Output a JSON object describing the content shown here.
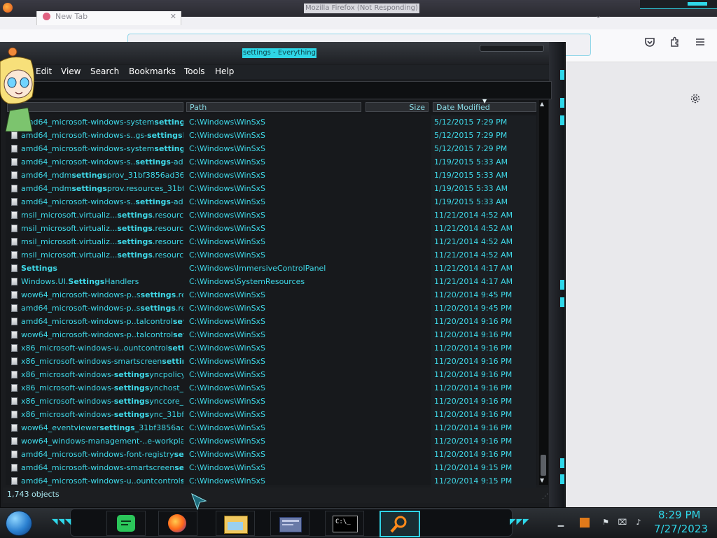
{
  "firefox": {
    "title": "Mozilla Firefox (Not Responding)",
    "tab_label": "New Tab",
    "tab_close": "✕"
  },
  "everything": {
    "title": "settings - Everything",
    "menu": [
      "Edit",
      "View",
      "Search",
      "Bookmarks",
      "Tools",
      "Help"
    ],
    "search_value": "",
    "columns": {
      "name": "",
      "path": "Path",
      "size": "Size",
      "date": "Date Modified"
    },
    "rows": [
      {
        "pre": "amd64_microsoft-windows-system",
        "hl": "settings",
        "post": "...",
        "path": "C:\\Windows\\WinSxS",
        "date": "5/12/2015 7:29 PM"
      },
      {
        "pre": "amd64_microsoft-windows-s..gs-",
        "hl": "settings",
        "post": "h...",
        "path": "C:\\Windows\\WinSxS",
        "date": "5/12/2015 7:29 PM"
      },
      {
        "pre": "amd64_microsoft-windows-system",
        "hl": "settings",
        "post": "...",
        "path": "C:\\Windows\\WinSxS",
        "date": "5/12/2015 7:29 PM"
      },
      {
        "pre": "amd64_microsoft-windows-s..",
        "hl": "settings",
        "post": "-ad...",
        "path": "C:\\Windows\\WinSxS",
        "date": "1/19/2015 5:33 AM"
      },
      {
        "pre": "amd64_mdm",
        "hl": "settings",
        "post": "prov_31bf3856ad364e...",
        "path": "C:\\Windows\\WinSxS",
        "date": "1/19/2015 5:33 AM"
      },
      {
        "pre": "amd64_mdm",
        "hl": "settings",
        "post": "prov.resources_31bf3...",
        "path": "C:\\Windows\\WinSxS",
        "date": "1/19/2015 5:33 AM"
      },
      {
        "pre": "amd64_microsoft-windows-s..",
        "hl": "settings",
        "post": "-ad...",
        "path": "C:\\Windows\\WinSxS",
        "date": "1/19/2015 5:33 AM"
      },
      {
        "pre": "msil_microsoft.virtualiz...",
        "hl": "settings",
        "post": ".resources...",
        "path": "C:\\Windows\\WinSxS",
        "date": "11/21/2014 4:52 AM"
      },
      {
        "pre": "msil_microsoft.virtualiz...",
        "hl": "settings",
        "post": ".resources...",
        "path": "C:\\Windows\\WinSxS",
        "date": "11/21/2014 4:52 AM"
      },
      {
        "pre": "msil_microsoft.virtualiz...",
        "hl": "settings",
        "post": ".resources...",
        "path": "C:\\Windows\\WinSxS",
        "date": "11/21/2014 4:52 AM"
      },
      {
        "pre": "msil_microsoft.virtualiz...",
        "hl": "settings",
        "post": ".resources...",
        "path": "C:\\Windows\\WinSxS",
        "date": "11/21/2014 4:52 AM"
      },
      {
        "pre": "",
        "hl": "Settings",
        "post": "",
        "path": "C:\\Windows\\ImmersiveControlPanel",
        "date": "11/21/2014 4:17 AM"
      },
      {
        "pre": "Windows.UI.",
        "hl": "Settings",
        "post": "Handlers",
        "path": "C:\\Windows\\SystemResources",
        "date": "11/21/2014 4:17 AM"
      },
      {
        "pre": "wow64_microsoft-windows-p..s",
        "hl": "settings",
        "post": ".res...",
        "path": "C:\\Windows\\WinSxS",
        "date": "11/20/2014 9:45 PM"
      },
      {
        "pre": "amd64_microsoft-windows-p..s",
        "hl": "settings",
        "post": ".res...",
        "path": "C:\\Windows\\WinSxS",
        "date": "11/20/2014 9:45 PM"
      },
      {
        "pre": "amd64_microsoft-windows-p..talcontrol",
        "hl": "set...",
        "post": "",
        "path": "C:\\Windows\\WinSxS",
        "date": "11/20/2014 9:16 PM"
      },
      {
        "pre": "wow64_microsoft-windows-p..talcontrol",
        "hl": "set...",
        "post": "",
        "path": "C:\\Windows\\WinSxS",
        "date": "11/20/2014 9:16 PM"
      },
      {
        "pre": "x86_microsoft-windows-u..ountcontrol",
        "hl": "setti...",
        "post": "",
        "path": "C:\\Windows\\WinSxS",
        "date": "11/20/2014 9:16 PM"
      },
      {
        "pre": "x86_microsoft-windows-smartscreen",
        "hl": "settin...",
        "post": "",
        "path": "C:\\Windows\\WinSxS",
        "date": "11/20/2014 9:16 PM"
      },
      {
        "pre": "x86_microsoft-windows-",
        "hl": "settings",
        "post": "yncpolicy_3...",
        "path": "C:\\Windows\\WinSxS",
        "date": "11/20/2014 9:16 PM"
      },
      {
        "pre": "x86_microsoft-windows-",
        "hl": "settings",
        "post": "ynchost_31...",
        "path": "C:\\Windows\\WinSxS",
        "date": "11/20/2014 9:16 PM"
      },
      {
        "pre": "x86_microsoft-windows-",
        "hl": "settings",
        "post": "ynccore_31...",
        "path": "C:\\Windows\\WinSxS",
        "date": "11/20/2014 9:16 PM"
      },
      {
        "pre": "x86_microsoft-windows-",
        "hl": "settings",
        "post": "ync_31bf38...",
        "path": "C:\\Windows\\WinSxS",
        "date": "11/20/2014 9:16 PM"
      },
      {
        "pre": "wow64_eventviewer",
        "hl": "settings",
        "post": "_31bf3856ad36...",
        "path": "C:\\Windows\\WinSxS",
        "date": "11/20/2014 9:16 PM"
      },
      {
        "pre": "wow64_windows-management-..e-workplac...",
        "hl": "",
        "post": "",
        "path": "C:\\Windows\\WinSxS",
        "date": "11/20/2014 9:16 PM"
      },
      {
        "pre": "amd64_microsoft-windows-font-registry",
        "hl": "set...",
        "post": "",
        "path": "C:\\Windows\\WinSxS",
        "date": "11/20/2014 9:16 PM"
      },
      {
        "pre": "amd64_microsoft-windows-smartscreen",
        "hl": "set...",
        "post": "",
        "path": "C:\\Windows\\WinSxS",
        "date": "11/20/2014 9:15 PM"
      },
      {
        "pre": "amd64_microsoft-windows-u..ountcontrol",
        "hl": "se...",
        "post": "",
        "path": "C:\\Windows\\WinSxS",
        "date": "11/20/2014 9:15 PM"
      }
    ],
    "status": "1,743 objects"
  },
  "taskbar": {
    "time": "8:29 PM",
    "date": "7/27/2023",
    "apps": [
      "notes-app-icon",
      "firefox-icon",
      "file-explorer-icon",
      "window-manager-icon",
      "terminal-icon",
      "search-everything-icon"
    ],
    "terminal_label": "C:\\_"
  },
  "colors": {
    "accent": "#2fd8ea",
    "highlight_text": "#3fd9e8"
  }
}
